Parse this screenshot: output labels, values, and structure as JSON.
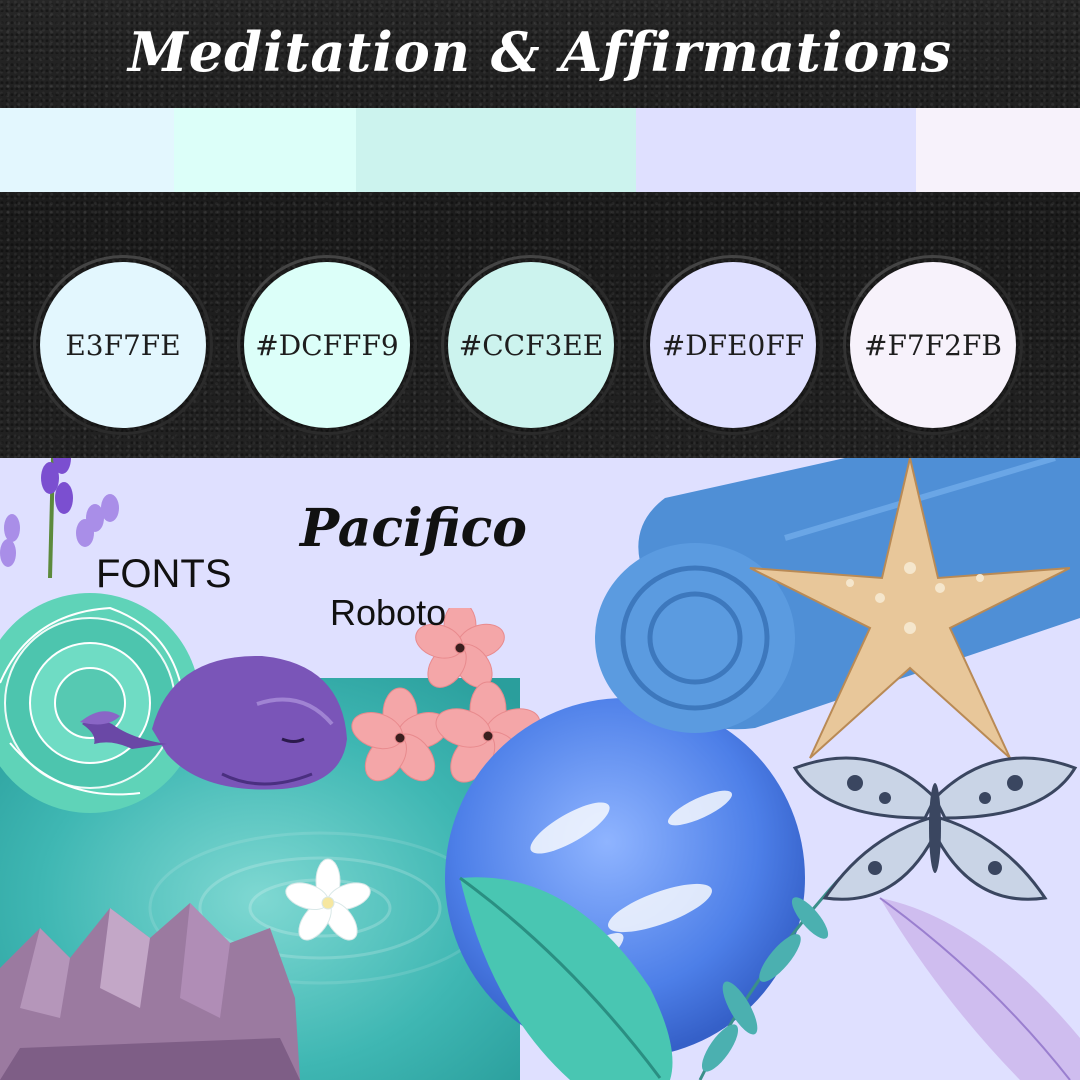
{
  "title": "Meditation & Affirmations",
  "palette": {
    "strip": [
      {
        "color": "#E3F7FE",
        "width": 174
      },
      {
        "color": "#DCFFF9",
        "width": 182
      },
      {
        "color": "#CCF3EE",
        "width": 280
      },
      {
        "color": "#DFE0FF",
        "width": 280
      },
      {
        "color": "#F7F2FB",
        "width": 164
      }
    ],
    "swatches": [
      {
        "label": "E3F7FE",
        "color": "#E3F7FE"
      },
      {
        "label": "#DCFFF9",
        "color": "#DCFFF9"
      },
      {
        "label": "#CCF3EE",
        "color": "#CCF3EE"
      },
      {
        "label": "#DFE0FF",
        "color": "#DFE0FF"
      },
      {
        "label": "#F7F2FB",
        "color": "#F7F2FB"
      }
    ]
  },
  "fonts": {
    "heading": "FONTS",
    "primary": "Pacifico",
    "secondary": "Roboto"
  },
  "decorations": [
    "lavender-icon",
    "flower-icon",
    "whale-icon",
    "water-ripple-icon",
    "amethyst-crystal-icon",
    "globe-icon",
    "leaf-icon",
    "towel-icon",
    "starfish-icon",
    "butterfly-icon",
    "feather-icon"
  ],
  "colors": {
    "sand": "#1f1f1f",
    "lower_bg": "#DFE0FF",
    "text_dark": "#111111"
  }
}
